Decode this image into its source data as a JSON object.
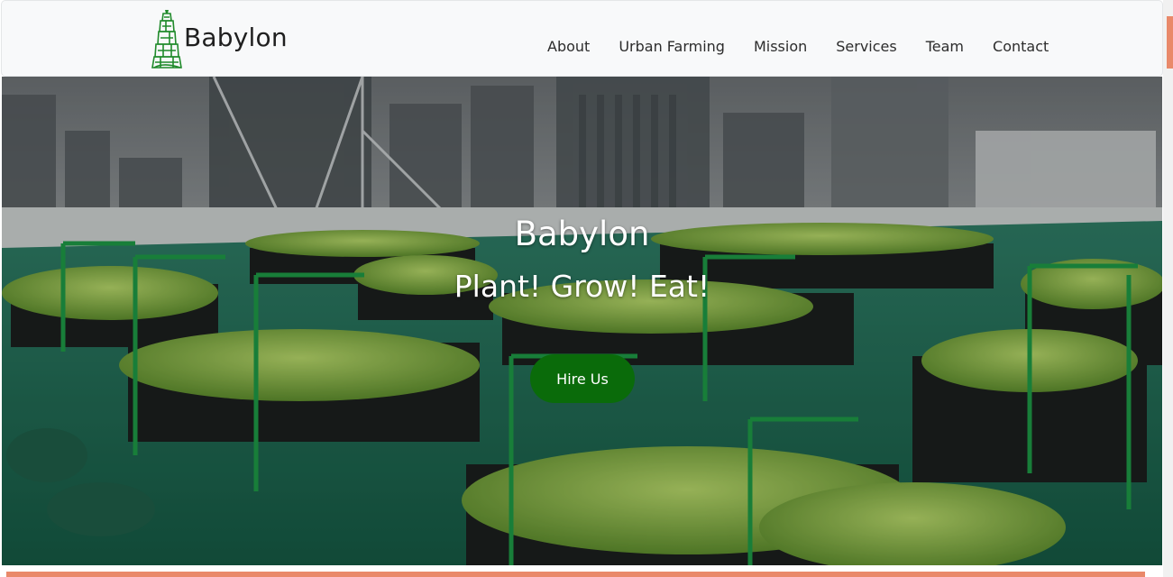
{
  "brand": {
    "name": "Babylon",
    "logo_icon": "tower-of-babel-icon",
    "logo_color": "#1f8a2a"
  },
  "nav": {
    "items": [
      {
        "label": "About"
      },
      {
        "label": "Urban Farming"
      },
      {
        "label": "Mission"
      },
      {
        "label": "Services"
      },
      {
        "label": "Team"
      },
      {
        "label": "Contact"
      }
    ]
  },
  "hero": {
    "title": "Babylon",
    "tagline": "Plant! Grow! Eat!",
    "cta_label": "Hire Us",
    "cta_color": "#0a6b0a",
    "background_image": "rooftop-urban-farm-photo"
  },
  "colors": {
    "accent": "#e9896a",
    "navbar_bg": "#f8f9fa",
    "rooftop_green": "#1f6e55"
  }
}
